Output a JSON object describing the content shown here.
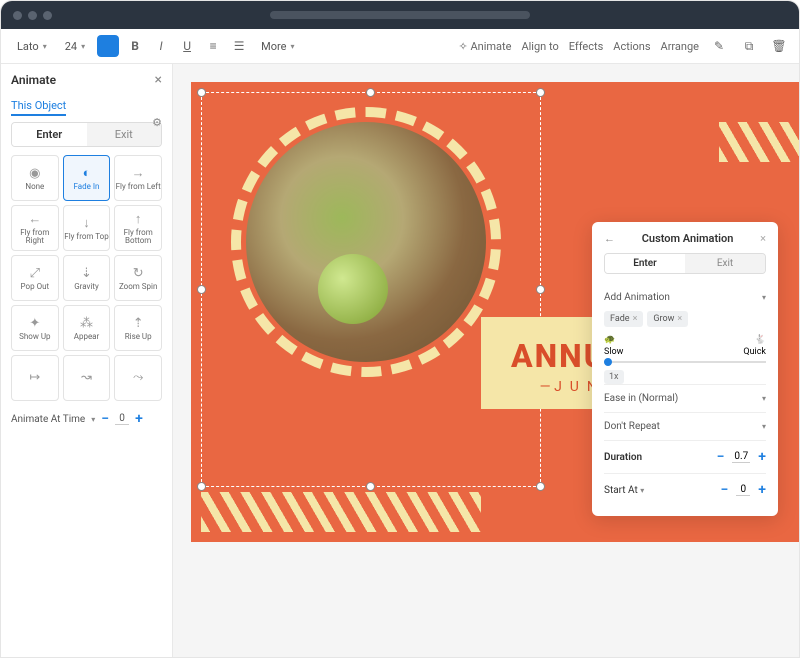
{
  "toolbar": {
    "font": "Lato",
    "size": "24",
    "more": "More",
    "right": {
      "animate": "Animate",
      "align": "Align to",
      "effects": "Effects",
      "actions": "Actions",
      "arrange": "Arrange"
    }
  },
  "sidebar": {
    "title": "Animate",
    "tab": "This Object",
    "enter": "Enter",
    "exit": "Exit",
    "anims": [
      {
        "label": "None",
        "icon": "◉"
      },
      {
        "label": "Fade In",
        "icon": "◐"
      },
      {
        "label": "Fly from Left",
        "icon": "→"
      },
      {
        "label": "Fly from Right",
        "icon": "←"
      },
      {
        "label": "Fly from Top",
        "icon": "↓"
      },
      {
        "label": "Fly from Bottom",
        "icon": "↑"
      },
      {
        "label": "Pop Out",
        "icon": "⤢"
      },
      {
        "label": "Gravity",
        "icon": "⇣"
      },
      {
        "label": "Zoom Spin",
        "icon": "↻"
      },
      {
        "label": "Show Up",
        "icon": "✦"
      },
      {
        "label": "Appear",
        "icon": "⁂"
      },
      {
        "label": "Rise Up",
        "icon": "⇡"
      },
      {
        "label": "",
        "icon": "↦"
      },
      {
        "label": "",
        "icon": "↝"
      },
      {
        "label": "",
        "icon": "⤳"
      }
    ],
    "footer": {
      "label": "Animate At Time",
      "value": "0"
    }
  },
  "canvas": {
    "title": "ANNUAL",
    "subtitle": "JUNE"
  },
  "popup": {
    "title": "Custom Animation",
    "enter": "Enter",
    "exit": "Exit",
    "addAnim": "Add Animation",
    "chips": [
      "Fade",
      "Grow"
    ],
    "slow": "Slow",
    "quick": "Quick",
    "speedTag": "1x",
    "easing": "Ease in (Normal)",
    "repeat": "Don't Repeat",
    "duration": {
      "label": "Duration",
      "value": "0.7"
    },
    "startAt": {
      "label": "Start At",
      "value": "0"
    }
  }
}
